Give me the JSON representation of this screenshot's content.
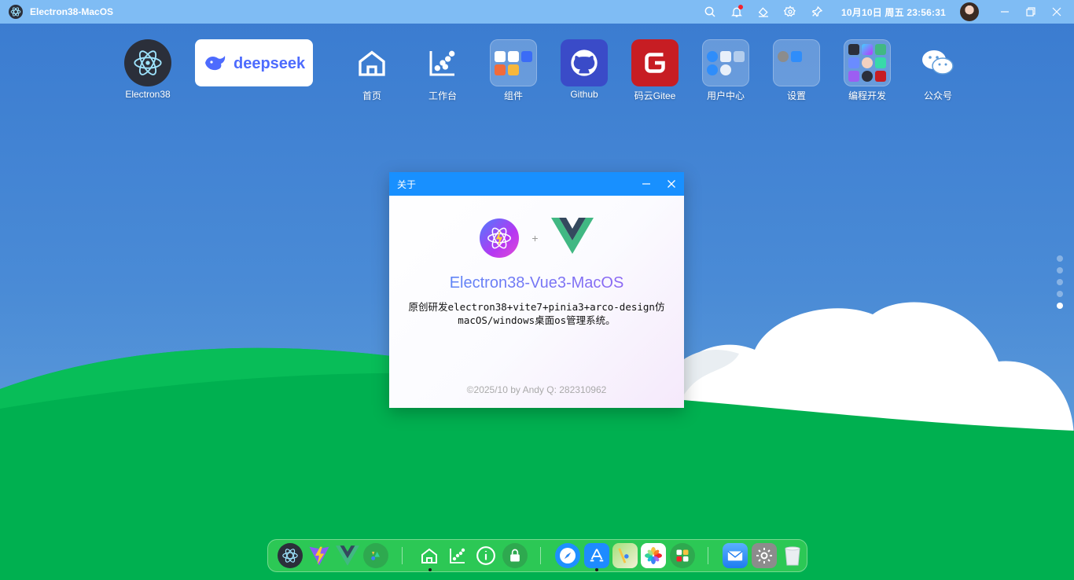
{
  "topbar": {
    "title": "Electron38-MacOS",
    "datetime": "10月10日 周五 23:56:31",
    "icons": [
      "search-icon",
      "bell-icon",
      "skin-icon",
      "gear-icon",
      "pin-icon"
    ],
    "window_controls": [
      "minimize-icon",
      "restore-icon",
      "close-icon"
    ]
  },
  "desktop": {
    "icons": [
      {
        "label": "Electron38"
      },
      {
        "label": "",
        "brand": "deepseek"
      },
      {
        "label": "首页"
      },
      {
        "label": "工作台"
      },
      {
        "label": "组件"
      },
      {
        "label": "Github"
      },
      {
        "label": "码云Gitee"
      },
      {
        "label": "用户中心"
      },
      {
        "label": "设置"
      },
      {
        "label": "编程开发"
      },
      {
        "label": "公众号"
      }
    ],
    "page_count": 5,
    "active_page": 5
  },
  "dialog": {
    "title": "关于",
    "plus": "+",
    "app_name": "Electron38-Vue3-MacOS",
    "description": "原创研发electron38+vite7+pinia3+arco-design仿macOS/windows桌面os管理系统。",
    "footer": "©2025/10 by Andy   Q: 282310962"
  },
  "dock": {
    "items": [
      "electron-icon",
      "vite-icon",
      "vue-icon",
      "app-icon",
      "home-icon",
      "chart-icon",
      "info-icon",
      "lock-icon",
      "safari-icon",
      "appstore-icon",
      "maps-icon",
      "photos-icon",
      "widgets-icon",
      "mail-icon",
      "settings-icon",
      "trash-icon"
    ]
  },
  "colors": {
    "topbar": "#7fbcf4",
    "dialog_header": "#1890ff",
    "hill": "#00b050",
    "sky": "#3d7fd1"
  }
}
